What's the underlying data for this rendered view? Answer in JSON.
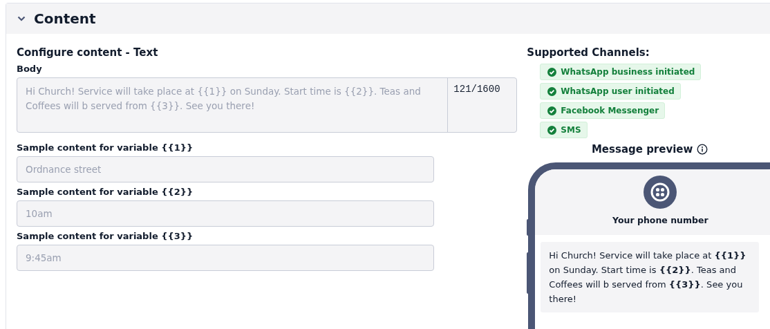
{
  "section": {
    "title": "Content",
    "expanded": true
  },
  "configure": {
    "title": "Configure content - Text",
    "body_label": "Body",
    "body_value": "Hi Church! Service will take place at {{1}} on Sunday. Start time is {{2}}. Teas and Coffees will b served from {{3}}. See you there!",
    "counter": "121/1600",
    "disabled": true
  },
  "variables": [
    {
      "label": "Sample content for variable {{1}}",
      "value": "Ordnance street",
      "disabled": true
    },
    {
      "label": "Sample content for variable {{2}}",
      "value": "10am",
      "disabled": true
    },
    {
      "label": "Sample content for variable {{3}}",
      "value": "9:45am",
      "disabled": true
    }
  ],
  "channels": {
    "title": "Supported Channels:",
    "items": [
      {
        "label": "WhatsApp business initiated",
        "supported": true
      },
      {
        "label": "WhatsApp user initiated",
        "supported": true
      },
      {
        "label": "Facebook Messenger",
        "supported": true
      },
      {
        "label": "SMS",
        "supported": true
      }
    ]
  },
  "preview": {
    "title": "Message preview",
    "sender": "Your phone number",
    "message": "Hi Church! Service will take place at **{{1}}** on Sunday. Start time is **{{2}}**. Teas and Coffees will b served from **{{3}}**. See you there!"
  }
}
